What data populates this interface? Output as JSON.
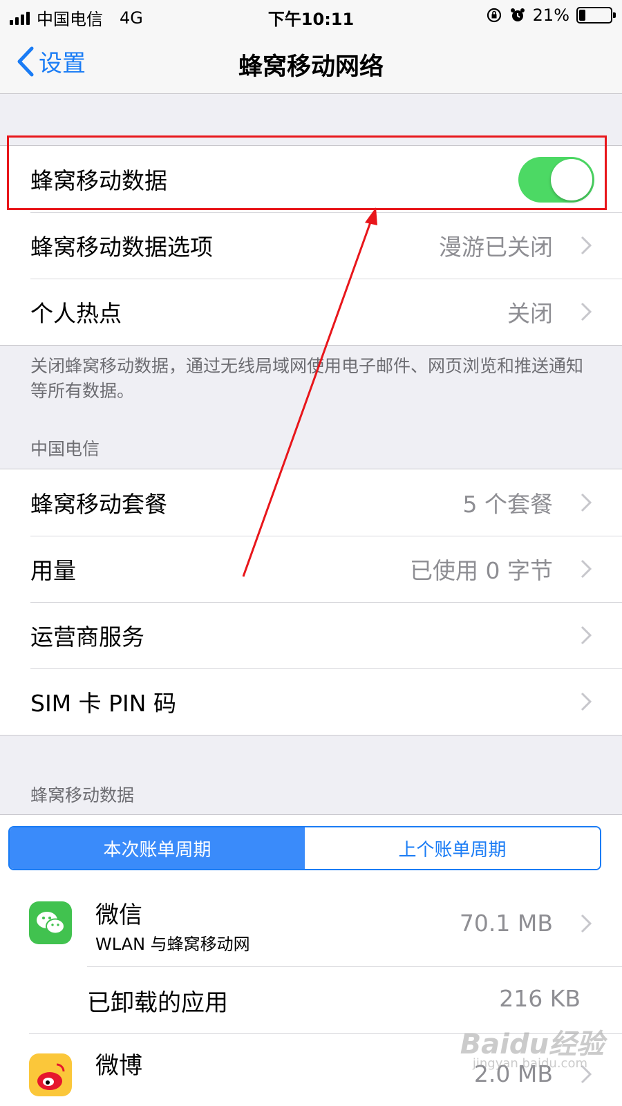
{
  "status_bar": {
    "carrier": "中国电信",
    "network": "4G",
    "time": "下午10:11",
    "battery": "21%",
    "battery_level": 0.21
  },
  "nav": {
    "back_label": "设置",
    "title": "蜂窝移动网络"
  },
  "cellular_data": {
    "label": "蜂窝移动数据",
    "enabled": true
  },
  "options_row": {
    "label": "蜂窝移动数据选项",
    "value": "漫游已关闭"
  },
  "hotspot_row": {
    "label": "个人热点",
    "value": "关闭"
  },
  "footer_note": "关闭蜂窝移动数据，通过无线局域网使用电子邮件、网页浏览和推送通知等所有数据。",
  "carrier_section": {
    "header": "中国电信",
    "rows": [
      {
        "label": "蜂窝移动套餐",
        "value": "5 个套餐"
      },
      {
        "label": "用量",
        "value": "已使用 0 字节"
      },
      {
        "label": "运营商服务",
        "value": ""
      },
      {
        "label": "SIM 卡 PIN 码",
        "value": ""
      }
    ]
  },
  "usage_section": {
    "header": "蜂窝移动数据",
    "segments": [
      "本次账单周期",
      "上个账单周期"
    ],
    "selected_segment": 0,
    "apps": [
      {
        "name": "微信",
        "subtitle": "WLAN 与蜂窝移动网",
        "size": "70.1 MB",
        "icon": "wechat-icon"
      },
      {
        "name": "已卸载的应用",
        "subtitle": "",
        "size": "216 KB",
        "icon": ""
      },
      {
        "name": "微博",
        "subtitle": "",
        "size": "2.0 MB",
        "icon": "weibo-icon"
      }
    ]
  },
  "watermark": {
    "text": "Baidu经验",
    "sub": "jingyan.baidu.com"
  },
  "colors": {
    "accent": "#1a7cf5",
    "toggle_on": "#4cd964",
    "highlight": "#e8161b",
    "background": "#efeff4"
  }
}
